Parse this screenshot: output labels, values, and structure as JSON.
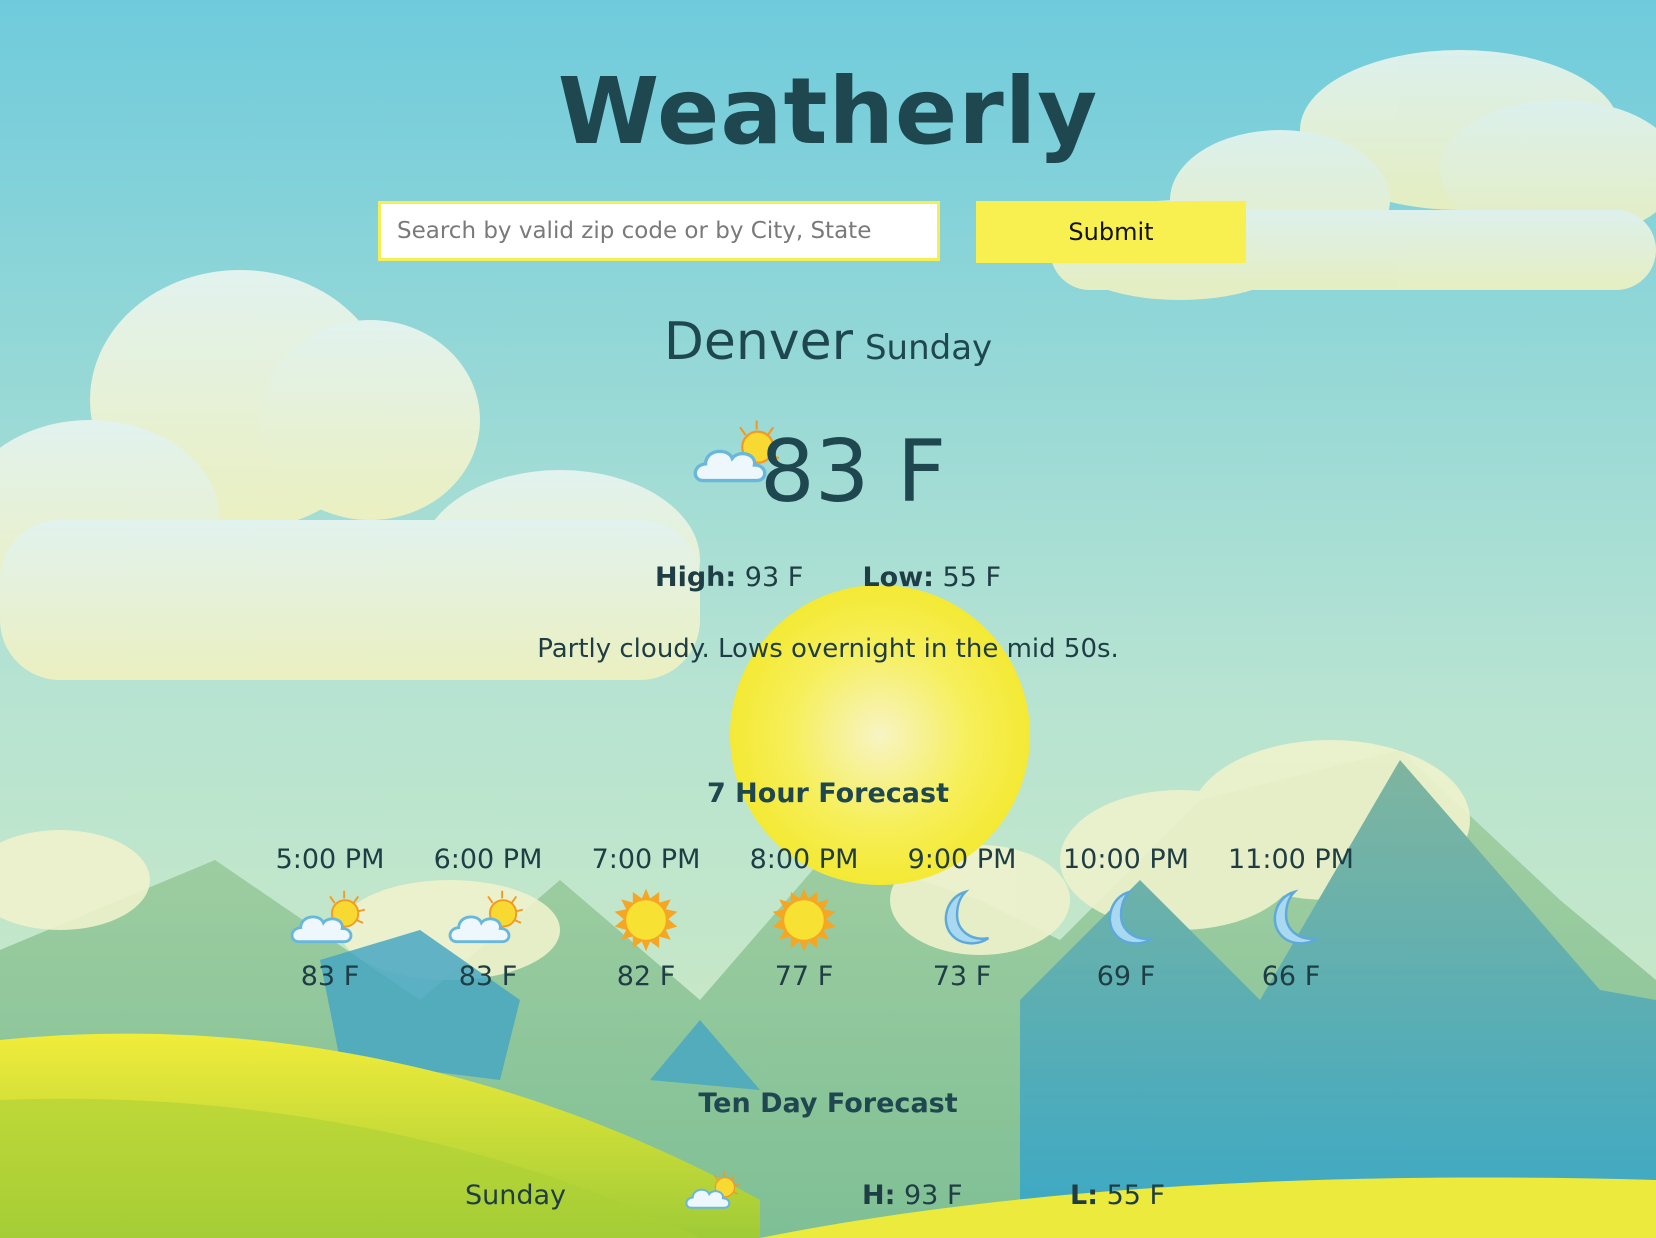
{
  "header": {
    "title": "Weatherly"
  },
  "search": {
    "placeholder": "Search by valid zip code or by City, State",
    "value": "",
    "submit_label": "Submit"
  },
  "current": {
    "city": "Denver",
    "day": "Sunday",
    "icon": "partly-cloudy-icon",
    "temp": "83 F",
    "high_label": "High:",
    "high": "93 F",
    "low_label": "Low:",
    "low": "55 F",
    "summary": "Partly cloudy. Lows overnight in the mid 50s."
  },
  "hourly": {
    "heading": "7 Hour Forecast",
    "items": [
      {
        "time": "5:00 PM",
        "icon": "partly-cloudy-icon",
        "temp": "83 F"
      },
      {
        "time": "6:00 PM",
        "icon": "partly-cloudy-icon",
        "temp": "83 F"
      },
      {
        "time": "7:00 PM",
        "icon": "sun-icon",
        "temp": "82 F"
      },
      {
        "time": "8:00 PM",
        "icon": "sun-icon",
        "temp": "77 F"
      },
      {
        "time": "9:00 PM",
        "icon": "moon-icon",
        "temp": "73 F"
      },
      {
        "time": "10:00 PM",
        "icon": "moon-icon",
        "temp": "69 F"
      },
      {
        "time": "11:00 PM",
        "icon": "moon-icon",
        "temp": "66 F"
      }
    ]
  },
  "daily": {
    "heading": "Ten Day Forecast",
    "items": [
      {
        "day": "Sunday",
        "icon": "partly-cloudy-icon",
        "high_label": "H:",
        "high": "93 F",
        "low_label": "L:",
        "low": "55 F"
      }
    ]
  },
  "colors": {
    "accent": "#f8ef51",
    "text": "#1f474f",
    "sky_top": "#6fcbdc",
    "sky_bottom": "#c6e6c4"
  }
}
